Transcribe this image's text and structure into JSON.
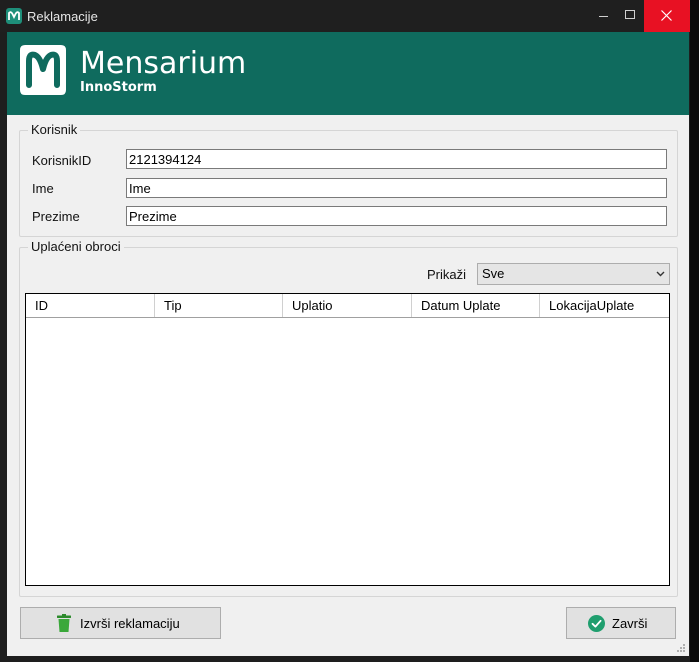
{
  "window": {
    "title": "Reklamacije"
  },
  "banner": {
    "brand": "Mensarium",
    "subtitle": "InnoStorm"
  },
  "korisnik": {
    "legend": "Korisnik",
    "fields": [
      {
        "label": "KorisnikID",
        "value": "2121394124"
      },
      {
        "label": "Ime",
        "value": "Ime"
      },
      {
        "label": "Prezime",
        "value": "Prezime"
      }
    ]
  },
  "uplaceni": {
    "legend": "Uplaćeni obroci",
    "filter_label": "Prikaži",
    "filter_value": "Sve",
    "columns": [
      "ID",
      "Tip",
      "Uplatio",
      "Datum Uplate",
      "LokacijaUplate"
    ]
  },
  "buttons": {
    "reklamacija": "Izvrši reklamaciju",
    "zavrsi": "Završi"
  },
  "colors": {
    "banner": "#0f6b5e",
    "close": "#e81123",
    "accent_green": "#1f9e6e"
  }
}
